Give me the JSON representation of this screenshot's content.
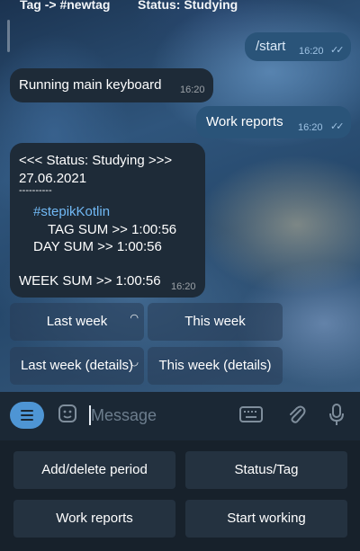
{
  "pinned": {
    "tag": "Tag -> #newtag",
    "status": "Status: Studying"
  },
  "messages": {
    "start": {
      "text": "/start",
      "time": "16:20"
    },
    "running": {
      "text": "Running main keyboard",
      "time": "16:20"
    },
    "work_reports": {
      "text": "Work reports",
      "time": "16:20"
    },
    "report": {
      "lines": [
        "<<< Status: Studying >>>",
        "27.06.2021",
        "----------",
        "#stepikKotlin",
        "TAG SUM >> 1:00:56",
        "DAY SUM >> 1:00:56",
        "WEEK SUM >> 1:00:56"
      ],
      "time": "16:20"
    }
  },
  "inline_keyboard": [
    "Last week",
    "This week",
    "Last week (details)",
    "This week (details)"
  ],
  "input": {
    "placeholder": "Message"
  },
  "reply_keyboard": [
    "Add/delete period",
    "Status/Tag",
    "Work reports",
    "Start working"
  ],
  "colors": {
    "accent": "#4e95d4",
    "outgoing_bubble": "#2a5479",
    "incoming_bubble": "#1e2b38",
    "hashtag": "#71b9f5"
  }
}
